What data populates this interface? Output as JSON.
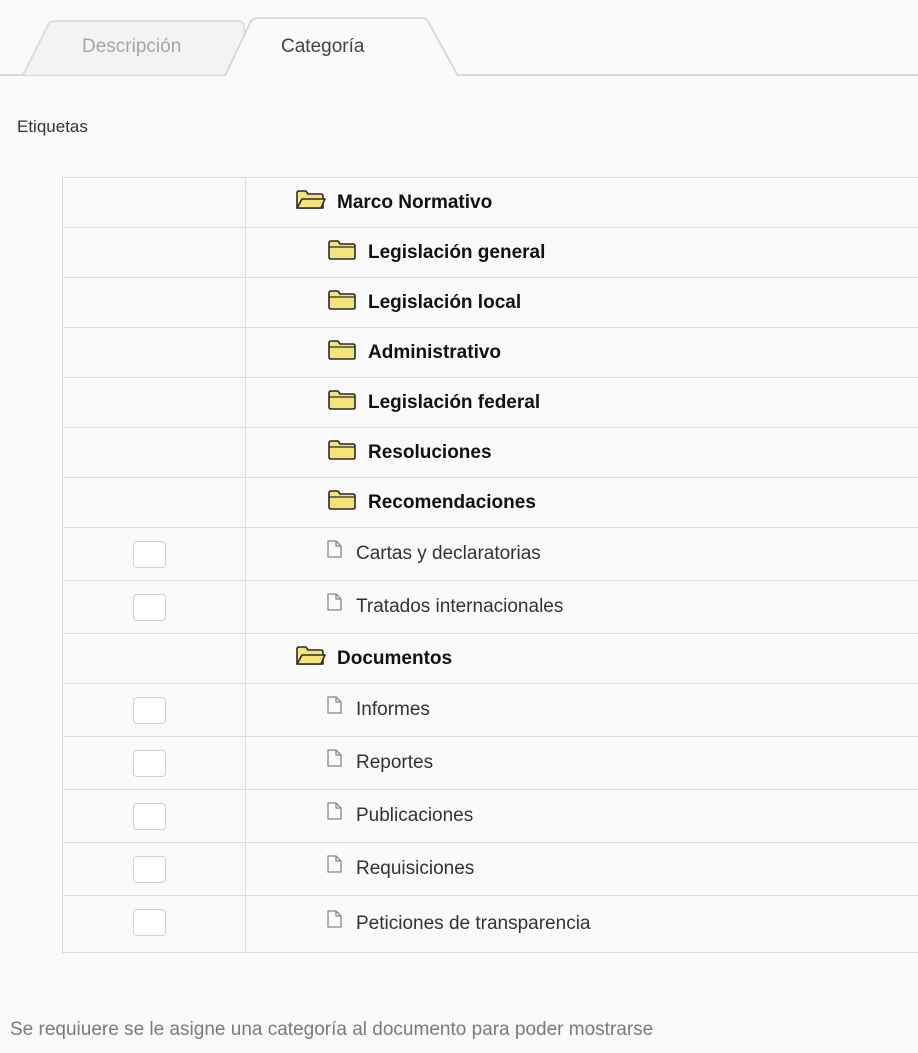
{
  "tabs": [
    {
      "label": "Descripción",
      "active": false
    },
    {
      "label": "Categoría",
      "active": true
    }
  ],
  "section_label": "Etiquetas",
  "tree": [
    {
      "type": "folder-open",
      "level": 0,
      "label": "Marco Normativo",
      "checkbox": false
    },
    {
      "type": "folder",
      "level": 1,
      "label": "Legislación general",
      "checkbox": false
    },
    {
      "type": "folder",
      "level": 1,
      "label": "Legislación local",
      "checkbox": false
    },
    {
      "type": "folder",
      "level": 1,
      "label": "Administrativo",
      "checkbox": false
    },
    {
      "type": "folder",
      "level": 1,
      "label": "Legislación federal",
      "checkbox": false
    },
    {
      "type": "folder",
      "level": 1,
      "label": "Resoluciones",
      "checkbox": false
    },
    {
      "type": "folder",
      "level": 1,
      "label": "Recomendaciones",
      "checkbox": false
    },
    {
      "type": "file",
      "level": 1,
      "label": "Cartas y declaratorias",
      "checkbox": true
    },
    {
      "type": "file",
      "level": 1,
      "label": "Tratados internacionales",
      "checkbox": true
    },
    {
      "type": "folder-open",
      "level": 0,
      "label": "Documentos",
      "checkbox": false
    },
    {
      "type": "file",
      "level": 1,
      "label": "Informes",
      "checkbox": true
    },
    {
      "type": "file",
      "level": 1,
      "label": "Reportes",
      "checkbox": true
    },
    {
      "type": "file",
      "level": 1,
      "label": "Publicaciones",
      "checkbox": true
    },
    {
      "type": "file",
      "level": 1,
      "label": "Requisiciones",
      "checkbox": true
    },
    {
      "type": "file",
      "level": 1,
      "label": "Peticiones de transparencia",
      "checkbox": true
    }
  ],
  "icons": {
    "folder-open": "folder-open-icon",
    "folder": "folder-icon",
    "file": "file-icon"
  },
  "colors": {
    "folder_fill": "#f4e27a",
    "folder_stroke": "#2b2b2b",
    "border": "#dcdcdc",
    "footer_text": "#7a7a7a"
  },
  "footer_note": "Se requiuere se le asigne una categoría al documento para poder mostrarse"
}
